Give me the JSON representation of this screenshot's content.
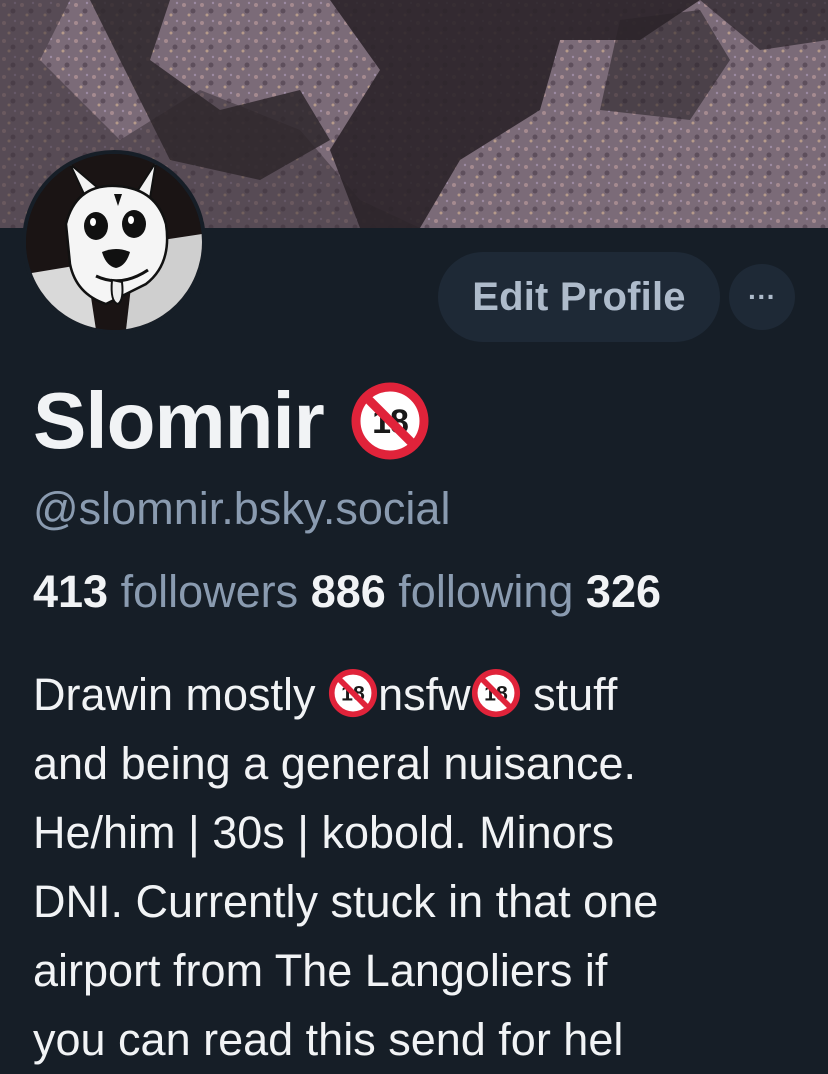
{
  "profile": {
    "display_name": "Slomnir",
    "name_badge_icon": "no-under-18-icon",
    "handle": "@slomnir.bsky.social",
    "edit_profile_label": "Edit Profile",
    "more_label": "···",
    "followers_count": "413",
    "followers_label": "followers",
    "following_count": "886",
    "following_label": "following",
    "posts_count": "326"
  },
  "bio": {
    "line1_a": "Drawin mostly ",
    "line1_b": "nsfw",
    "line1_c": " stuff",
    "line2": "and being a general nuisance.",
    "line3": "He/him | 30s | kobold. Minors",
    "line4": "DNI. Currently stuck in that one",
    "line5": "airport from The Langoliers if",
    "line6": "you can read this send for hel"
  },
  "colors": {
    "background": "#161e27",
    "button_bg": "#1e2936",
    "muted_text": "#8a9bb0",
    "primary_text": "#f1f3f5",
    "badge_red": "#e0233a"
  }
}
